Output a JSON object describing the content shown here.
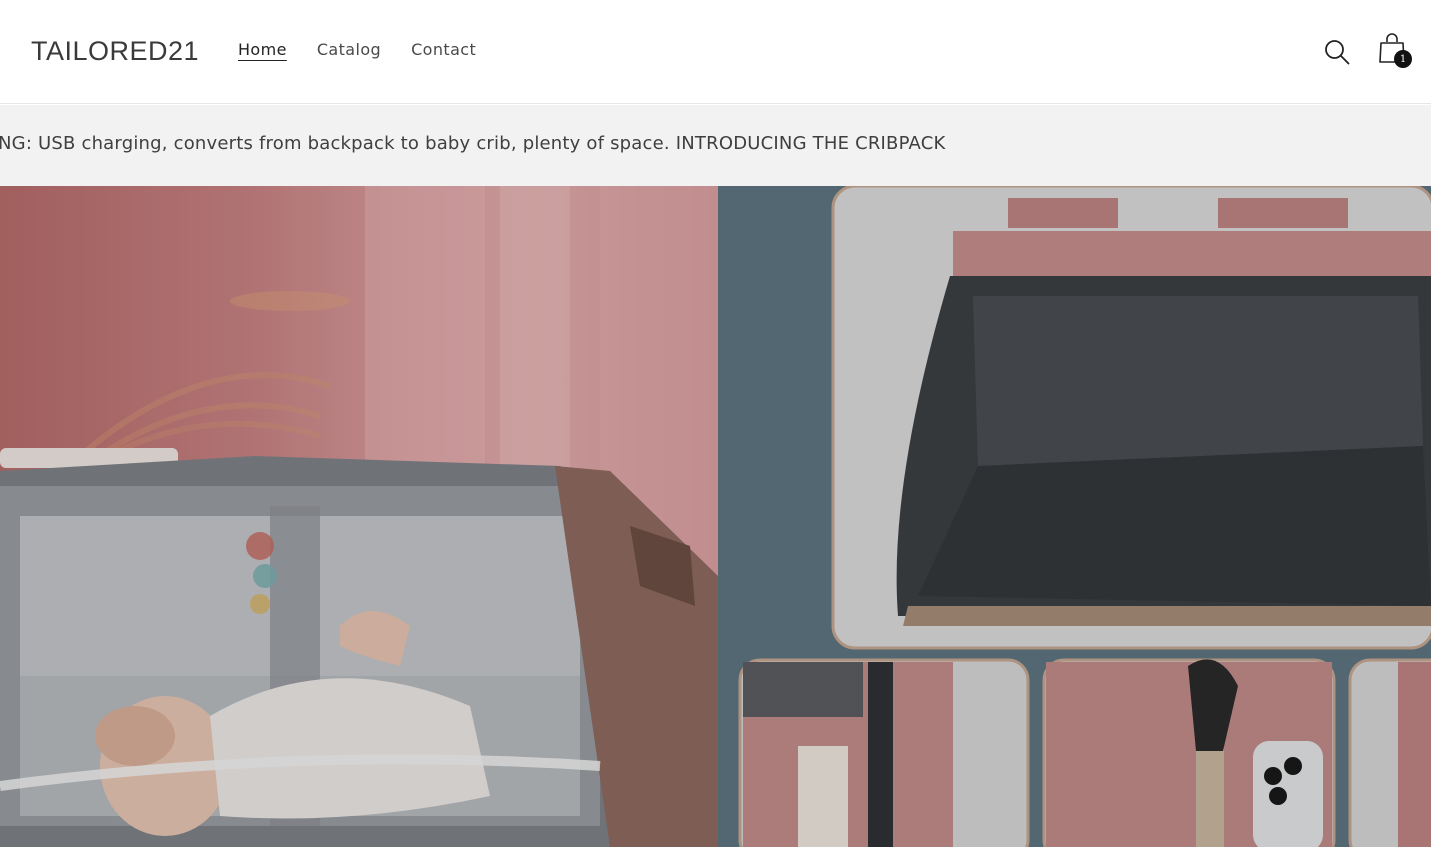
{
  "header": {
    "logo": "TAILORED21",
    "nav": [
      {
        "label": "Home",
        "active": true
      },
      {
        "label": "Catalog",
        "active": false
      },
      {
        "label": "Contact",
        "active": false
      }
    ],
    "search_icon": "search-icon",
    "cart_icon": "shopping-bag-icon",
    "cart_count": "1"
  },
  "announcement": {
    "text": "NG: USB charging, converts from backpack to baby crib, plenty of space. INTRODUCING THE CRIBPACK"
  },
  "hero": {
    "left_image": "baby-in-crib-backpack-photo",
    "right_image": "open-pink-backpack-collage-photo"
  },
  "colors": {
    "announcement_bg": "#f2f2f2",
    "cart_badge": "#121212",
    "backpack_pink": "#c08b88",
    "collage_bg": "#5f7682"
  }
}
